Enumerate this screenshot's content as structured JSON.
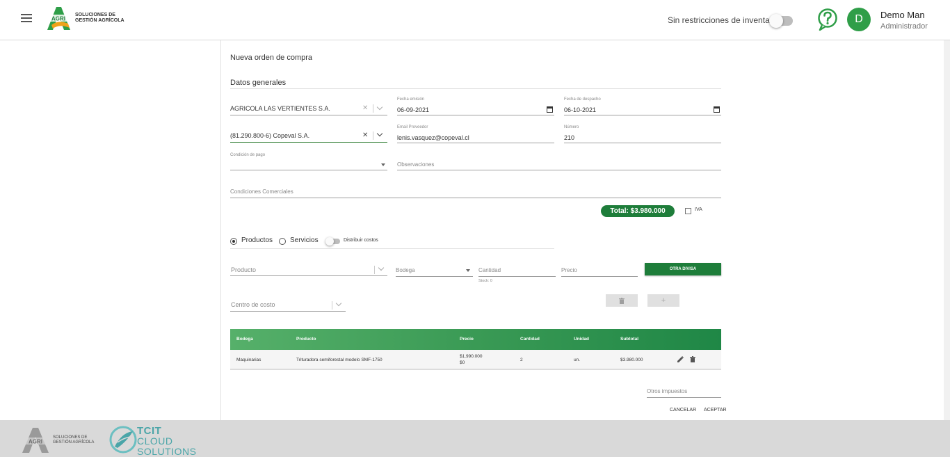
{
  "header": {
    "logo_mark": "AGRI",
    "logo_text_line1": "SOLUCIONES DE",
    "logo_text_line2": "GESTIÓN AGRÍCOLA",
    "inventory_toggle_label": "Sin restricciones de inventario",
    "user": {
      "avatar_initial": "D",
      "name": "Demo Man",
      "role": "Administrador"
    }
  },
  "form": {
    "title": "Nueva orden de compra",
    "section_general": "Datos generales",
    "company": {
      "value": "AGRICOLA LAS VERTIENTES S.A."
    },
    "fecha_emision": {
      "label": "Fecha emisión",
      "value": "06-09-2021"
    },
    "fecha_despacho": {
      "label": "Fecha de despacho",
      "value": "06-10-2021"
    },
    "proveedor": {
      "value": "(81.290.800-6) Copeval S.A."
    },
    "email_proveedor": {
      "label": "Email Proveedor",
      "value": "lenis.vasquez@copeval.cl"
    },
    "numero": {
      "label": "Número",
      "value": "210"
    },
    "condicion_pago": {
      "label": "Condición de pago",
      "value": ""
    },
    "observaciones": {
      "placeholder": "Observaciones"
    },
    "condiciones_comerciales": {
      "placeholder": "Condiciones Comerciales"
    },
    "total_badge": "Total: $3.980.000",
    "iva_label": "IVA"
  },
  "items": {
    "radio_productos": "Productos",
    "radio_servicios": "Servicios",
    "selected": "Productos",
    "distribuir_label": "Distribuir costos",
    "producto_placeholder": "Producto",
    "bodega_placeholder": "Bodega",
    "cantidad_placeholder": "Cantidad",
    "stock_hint": "Stock: 0",
    "precio_placeholder": "Precio",
    "otra_divisa_button": "OTRA DIVISA",
    "centro_costo_placeholder": "Centro de costo",
    "delete_button_icon": "trash-icon",
    "add_button_label": "+"
  },
  "table": {
    "headers": [
      "Bodega",
      "Producto",
      "Precio",
      "Cantidad",
      "Unidad",
      "Subtotal"
    ],
    "rows": [
      {
        "bodega": "Maquinarias",
        "producto": "Trituradora semiforestal modelo SMF-1750",
        "precio_line1": "$1.990.000",
        "precio_line2": "$0",
        "cantidad": "2",
        "unidad": "un.",
        "subtotal": "$3.980.000"
      }
    ]
  },
  "footer_form": {
    "otros_impuestos_placeholder": "Otros impuestos",
    "cancel_label": "CANCELAR",
    "accept_label": "ACEPTAR"
  },
  "footer": {
    "logo_mark": "AGRI",
    "logo_text_line1": "SOLUCIONES DE",
    "logo_text_line2": "GESTIÓN AGRÍCOLA",
    "tcit_line1": "TCIT",
    "tcit_line2": "CLOUD",
    "tcit_line3": "SOLUTIONS"
  },
  "colors": {
    "primary_green": "#1e7d3a",
    "avatar_green": "#2f9e48",
    "table_gradient_start": "#56b06a",
    "table_gradient_end": "#1f8746",
    "footer_bg": "#d9d9d9",
    "tcit_teal": "#4aa5a8"
  }
}
